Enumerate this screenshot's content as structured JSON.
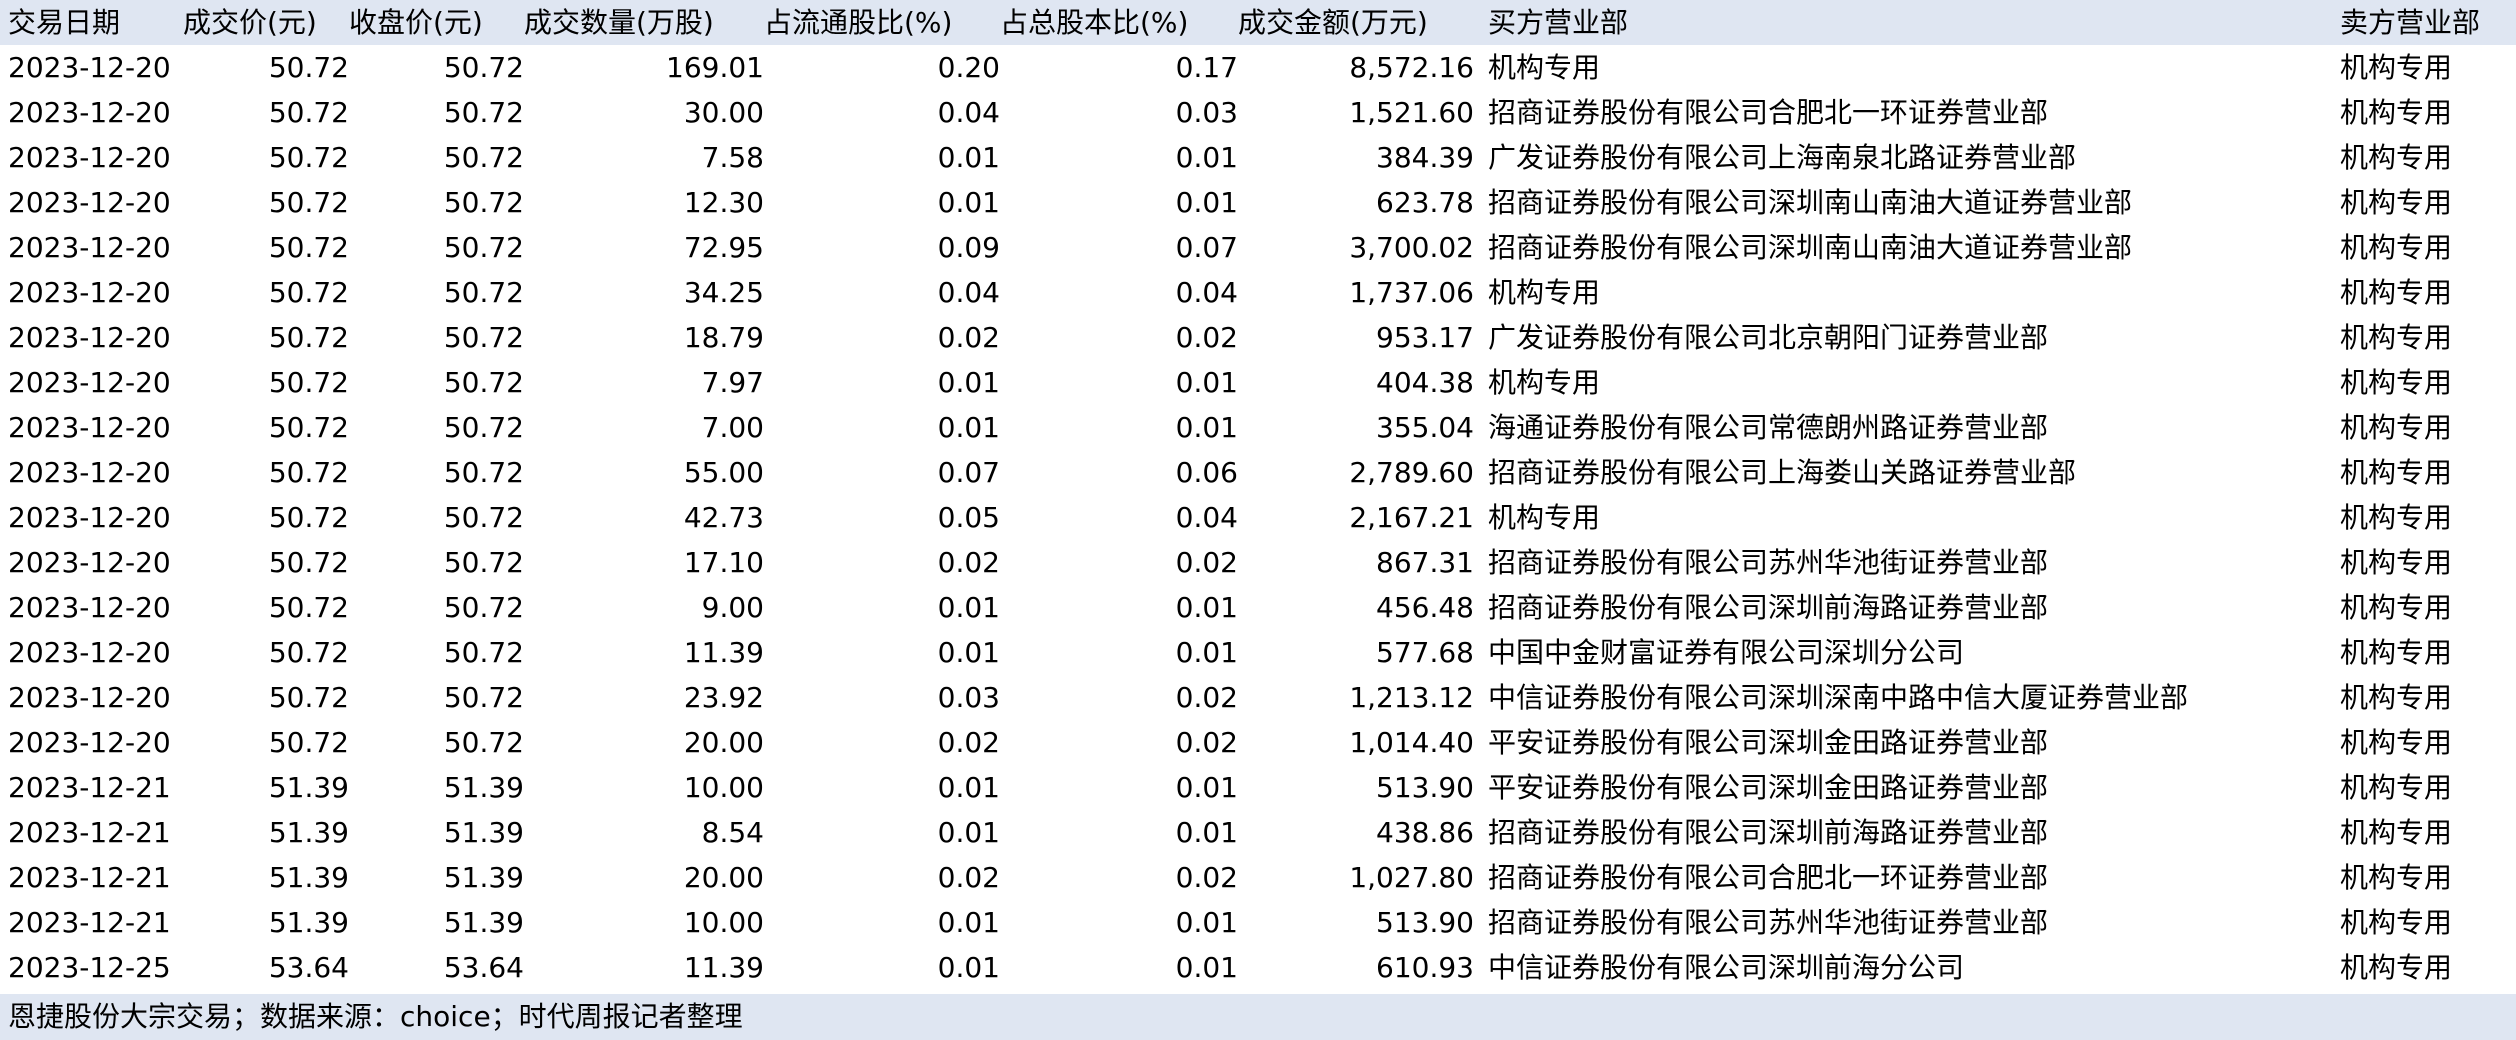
{
  "table": {
    "headers": {
      "date": "交易日期",
      "price": "成交价(元)",
      "close": "收盘价(元)",
      "volume": "成交数量(万股)",
      "float_pct": "占流通股比(%)",
      "total_pct": "占总股本比(%)",
      "amount": "成交金额(万元)",
      "buyer": "买方营业部",
      "seller": "卖方营业部"
    },
    "rows": [
      {
        "date": "2023-12-20",
        "price": "50.72",
        "close": "50.72",
        "volume": "169.01",
        "float_pct": "0.20",
        "total_pct": "0.17",
        "amount": "8,572.16",
        "buyer": "机构专用",
        "seller": "机构专用"
      },
      {
        "date": "2023-12-20",
        "price": "50.72",
        "close": "50.72",
        "volume": "30.00",
        "float_pct": "0.04",
        "total_pct": "0.03",
        "amount": "1,521.60",
        "buyer": "招商证券股份有限公司合肥北一环证券营业部",
        "seller": "机构专用"
      },
      {
        "date": "2023-12-20",
        "price": "50.72",
        "close": "50.72",
        "volume": "7.58",
        "float_pct": "0.01",
        "total_pct": "0.01",
        "amount": "384.39",
        "buyer": "广发证券股份有限公司上海南泉北路证券营业部",
        "seller": "机构专用"
      },
      {
        "date": "2023-12-20",
        "price": "50.72",
        "close": "50.72",
        "volume": "12.30",
        "float_pct": "0.01",
        "total_pct": "0.01",
        "amount": "623.78",
        "buyer": "招商证券股份有限公司深圳南山南油大道证券营业部",
        "seller": "机构专用"
      },
      {
        "date": "2023-12-20",
        "price": "50.72",
        "close": "50.72",
        "volume": "72.95",
        "float_pct": "0.09",
        "total_pct": "0.07",
        "amount": "3,700.02",
        "buyer": "招商证券股份有限公司深圳南山南油大道证券营业部",
        "seller": "机构专用"
      },
      {
        "date": "2023-12-20",
        "price": "50.72",
        "close": "50.72",
        "volume": "34.25",
        "float_pct": "0.04",
        "total_pct": "0.04",
        "amount": "1,737.06",
        "buyer": "机构专用",
        "seller": "机构专用"
      },
      {
        "date": "2023-12-20",
        "price": "50.72",
        "close": "50.72",
        "volume": "18.79",
        "float_pct": "0.02",
        "total_pct": "0.02",
        "amount": "953.17",
        "buyer": "广发证券股份有限公司北京朝阳门证券营业部",
        "seller": "机构专用"
      },
      {
        "date": "2023-12-20",
        "price": "50.72",
        "close": "50.72",
        "volume": "7.97",
        "float_pct": "0.01",
        "total_pct": "0.01",
        "amount": "404.38",
        "buyer": "机构专用",
        "seller": "机构专用"
      },
      {
        "date": "2023-12-20",
        "price": "50.72",
        "close": "50.72",
        "volume": "7.00",
        "float_pct": "0.01",
        "total_pct": "0.01",
        "amount": "355.04",
        "buyer": "海通证券股份有限公司常德朗州路证券营业部",
        "seller": "机构专用"
      },
      {
        "date": "2023-12-20",
        "price": "50.72",
        "close": "50.72",
        "volume": "55.00",
        "float_pct": "0.07",
        "total_pct": "0.06",
        "amount": "2,789.60",
        "buyer": "招商证券股份有限公司上海娄山关路证券营业部",
        "seller": "机构专用"
      },
      {
        "date": "2023-12-20",
        "price": "50.72",
        "close": "50.72",
        "volume": "42.73",
        "float_pct": "0.05",
        "total_pct": "0.04",
        "amount": "2,167.21",
        "buyer": "机构专用",
        "seller": "机构专用"
      },
      {
        "date": "2023-12-20",
        "price": "50.72",
        "close": "50.72",
        "volume": "17.10",
        "float_pct": "0.02",
        "total_pct": "0.02",
        "amount": "867.31",
        "buyer": "招商证券股份有限公司苏州华池街证券营业部",
        "seller": "机构专用"
      },
      {
        "date": "2023-12-20",
        "price": "50.72",
        "close": "50.72",
        "volume": "9.00",
        "float_pct": "0.01",
        "total_pct": "0.01",
        "amount": "456.48",
        "buyer": "招商证券股份有限公司深圳前海路证券营业部",
        "seller": "机构专用"
      },
      {
        "date": "2023-12-20",
        "price": "50.72",
        "close": "50.72",
        "volume": "11.39",
        "float_pct": "0.01",
        "total_pct": "0.01",
        "amount": "577.68",
        "buyer": "中国中金财富证券有限公司深圳分公司",
        "seller": "机构专用"
      },
      {
        "date": "2023-12-20",
        "price": "50.72",
        "close": "50.72",
        "volume": "23.92",
        "float_pct": "0.03",
        "total_pct": "0.02",
        "amount": "1,213.12",
        "buyer": "中信证券股份有限公司深圳深南中路中信大厦证券营业部",
        "seller": "机构专用"
      },
      {
        "date": "2023-12-20",
        "price": "50.72",
        "close": "50.72",
        "volume": "20.00",
        "float_pct": "0.02",
        "total_pct": "0.02",
        "amount": "1,014.40",
        "buyer": "平安证券股份有限公司深圳金田路证券营业部",
        "seller": "机构专用"
      },
      {
        "date": "2023-12-21",
        "price": "51.39",
        "close": "51.39",
        "volume": "10.00",
        "float_pct": "0.01",
        "total_pct": "0.01",
        "amount": "513.90",
        "buyer": "平安证券股份有限公司深圳金田路证券营业部",
        "seller": "机构专用"
      },
      {
        "date": "2023-12-21",
        "price": "51.39",
        "close": "51.39",
        "volume": "8.54",
        "float_pct": "0.01",
        "total_pct": "0.01",
        "amount": "438.86",
        "buyer": "招商证券股份有限公司深圳前海路证券营业部",
        "seller": "机构专用"
      },
      {
        "date": "2023-12-21",
        "price": "51.39",
        "close": "51.39",
        "volume": "20.00",
        "float_pct": "0.02",
        "total_pct": "0.02",
        "amount": "1,027.80",
        "buyer": "招商证券股份有限公司合肥北一环证券营业部",
        "seller": "机构专用"
      },
      {
        "date": "2023-12-21",
        "price": "51.39",
        "close": "51.39",
        "volume": "10.00",
        "float_pct": "0.01",
        "total_pct": "0.01",
        "amount": "513.90",
        "buyer": "招商证券股份有限公司苏州华池街证券营业部",
        "seller": "机构专用"
      },
      {
        "date": "2023-12-25",
        "price": "53.64",
        "close": "53.64",
        "volume": "11.39",
        "float_pct": "0.01",
        "total_pct": "0.01",
        "amount": "610.93",
        "buyer": "中信证券股份有限公司深圳前海分公司",
        "seller": "机构专用"
      }
    ]
  },
  "footer": {
    "note": "恩捷股份大宗交易；数据来源：choice；时代周报记者整理"
  },
  "colors": {
    "header_bg": "#dfe6f2",
    "text": "#000000"
  }
}
